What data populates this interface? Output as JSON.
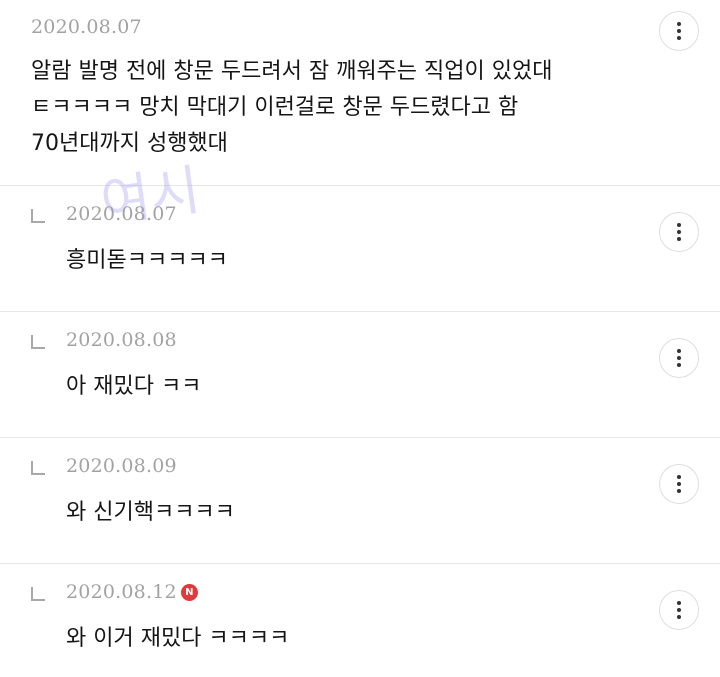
{
  "comments": {
    "main": {
      "date": "2020.08.07",
      "lines": [
        "알람 발명 전에 창문 두드려서 잠 깨워주는 직업이 있었대",
        "ㅌㅋㅋㅋㅋ 망치 막대기 이런걸로 창문 두드렸다고 함",
        "70년대까지 성행했대"
      ],
      "more_icon": "more-vertical-icon"
    },
    "replies": [
      {
        "date": "2020.08.07",
        "text": "흥미돋ㅋㅋㅋㅋㅋ",
        "badge": ""
      },
      {
        "date": "2020.08.08",
        "text": "아 재밌다 ㅋㅋ",
        "badge": ""
      },
      {
        "date": "2020.08.09",
        "text": "와 신기핵ㅋㅋㅋㅋ",
        "badge": ""
      },
      {
        "date": "2020.08.12",
        "text": "와 이거 재밌다 ㅋㅋㅋㅋ",
        "badge": "N"
      }
    ]
  },
  "watermark": "여시",
  "colors": {
    "badge": "#e03a3a",
    "date": "#a2a2a2",
    "divider": "#e7e7e7",
    "watermark": "#968ceb"
  }
}
